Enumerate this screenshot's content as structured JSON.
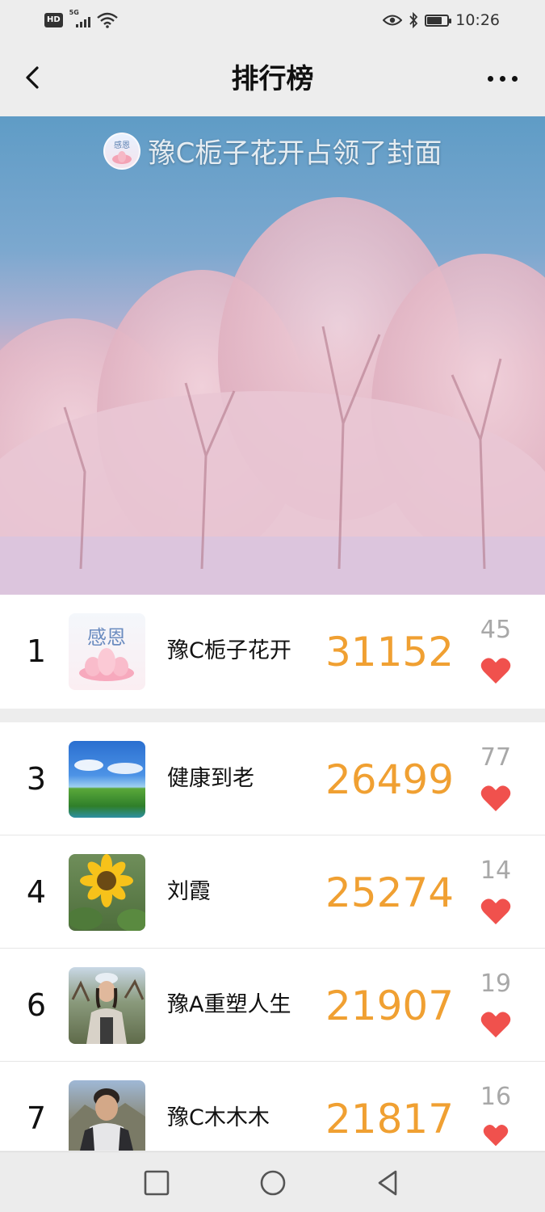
{
  "status_bar": {
    "hd_label": "HD",
    "network": "5G",
    "time": "10:26",
    "battery_level": 0.7
  },
  "nav": {
    "title": "排行榜",
    "back_icon": "back-chevron-icon",
    "more_icon": "more-dots-icon"
  },
  "cover": {
    "banner_text": "豫C栀子花开占领了封面",
    "avatar_text": "感恩"
  },
  "ranking": [
    {
      "rank": "1",
      "name": "豫C栀子花开",
      "steps": "31152",
      "likes": "45",
      "avatar": "lotus-thanks"
    },
    {
      "rank": "3",
      "name": "健康到老",
      "steps": "26499",
      "likes": "77",
      "avatar": "sky-landscape"
    },
    {
      "rank": "4",
      "name": "刘霞",
      "steps": "25274",
      "likes": "14",
      "avatar": "sunflower"
    },
    {
      "rank": "6",
      "name": "豫A重塑人生",
      "steps": "21907",
      "likes": "19",
      "avatar": "woman-outdoors"
    },
    {
      "rank": "7",
      "name": "豫C木木木",
      "steps": "21817",
      "likes": "16",
      "avatar": "person-portrait"
    }
  ],
  "colors": {
    "steps": "#f0a032",
    "heart": "#f0514d",
    "likes": "#a8a8a8"
  },
  "android_nav": {
    "recent_icon": "square-icon",
    "home_icon": "circle-icon",
    "back_icon": "triangle-back-icon"
  }
}
